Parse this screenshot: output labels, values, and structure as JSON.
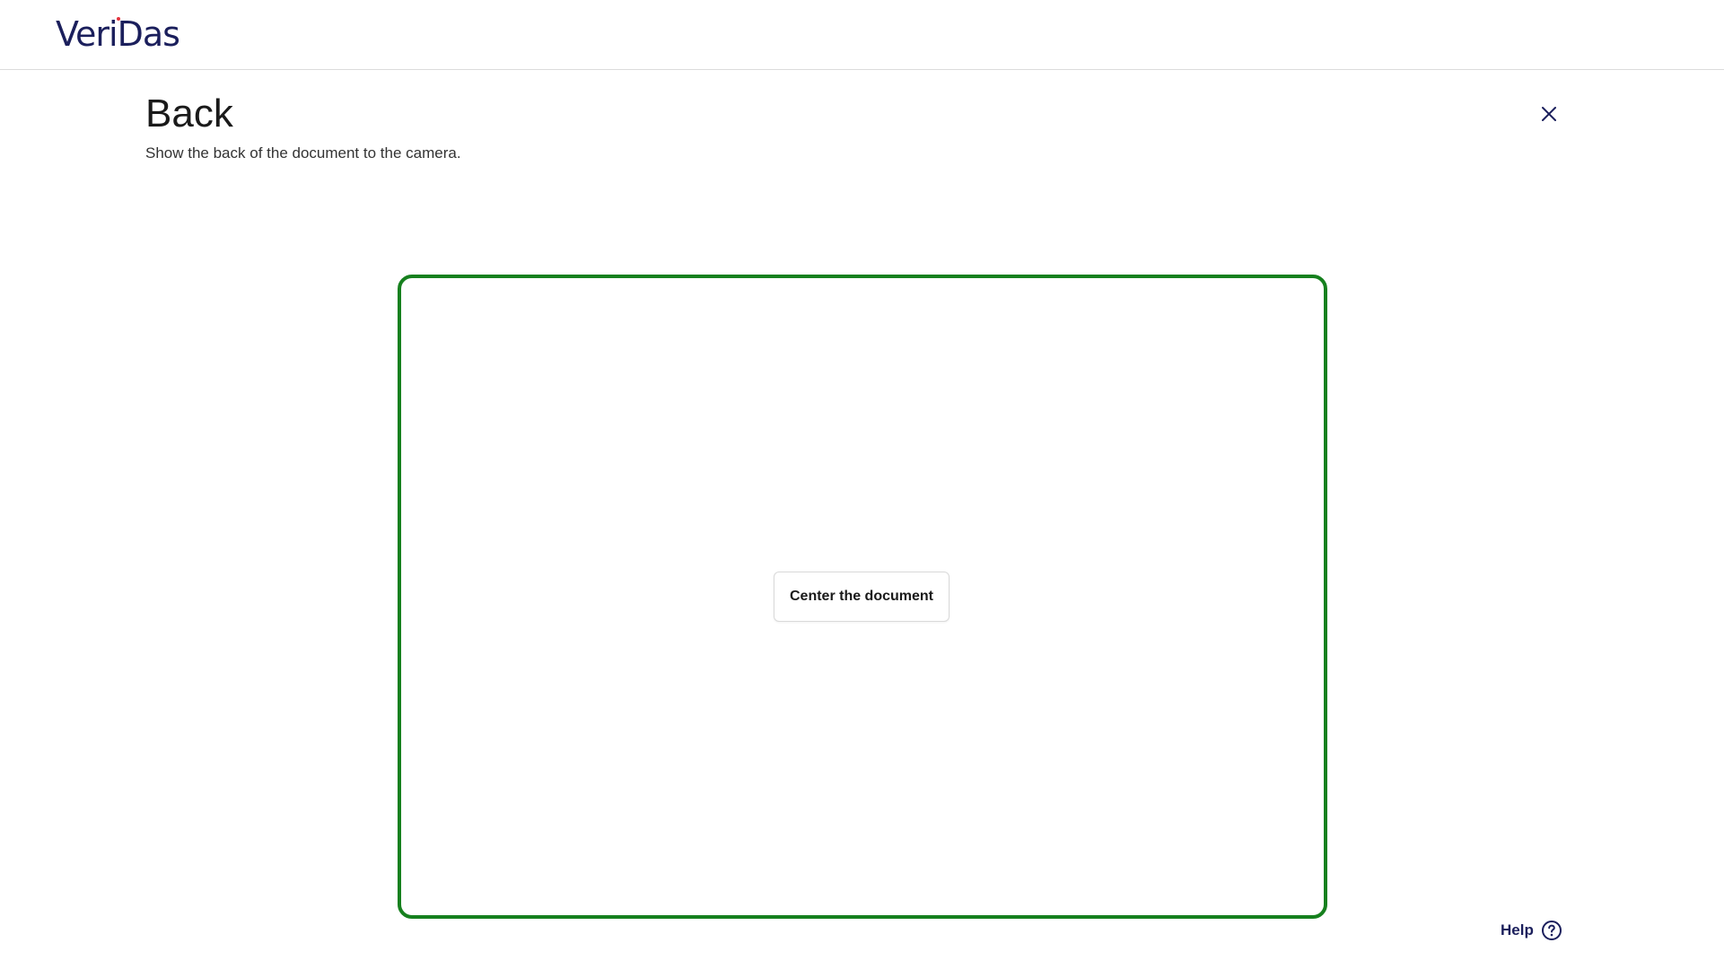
{
  "header": {
    "logo_text": "VeriDas",
    "brand_color": "#1b1f5c",
    "logo_accent_color": "#e4323c"
  },
  "main": {
    "title": "Back",
    "subtitle": "Show the back of the document to the camera.",
    "close_icon": "close-icon"
  },
  "capture": {
    "frame_color": "#16801e",
    "hint": "Center the document"
  },
  "footer": {
    "help_label": "Help",
    "help_icon": "question-circle-icon"
  }
}
